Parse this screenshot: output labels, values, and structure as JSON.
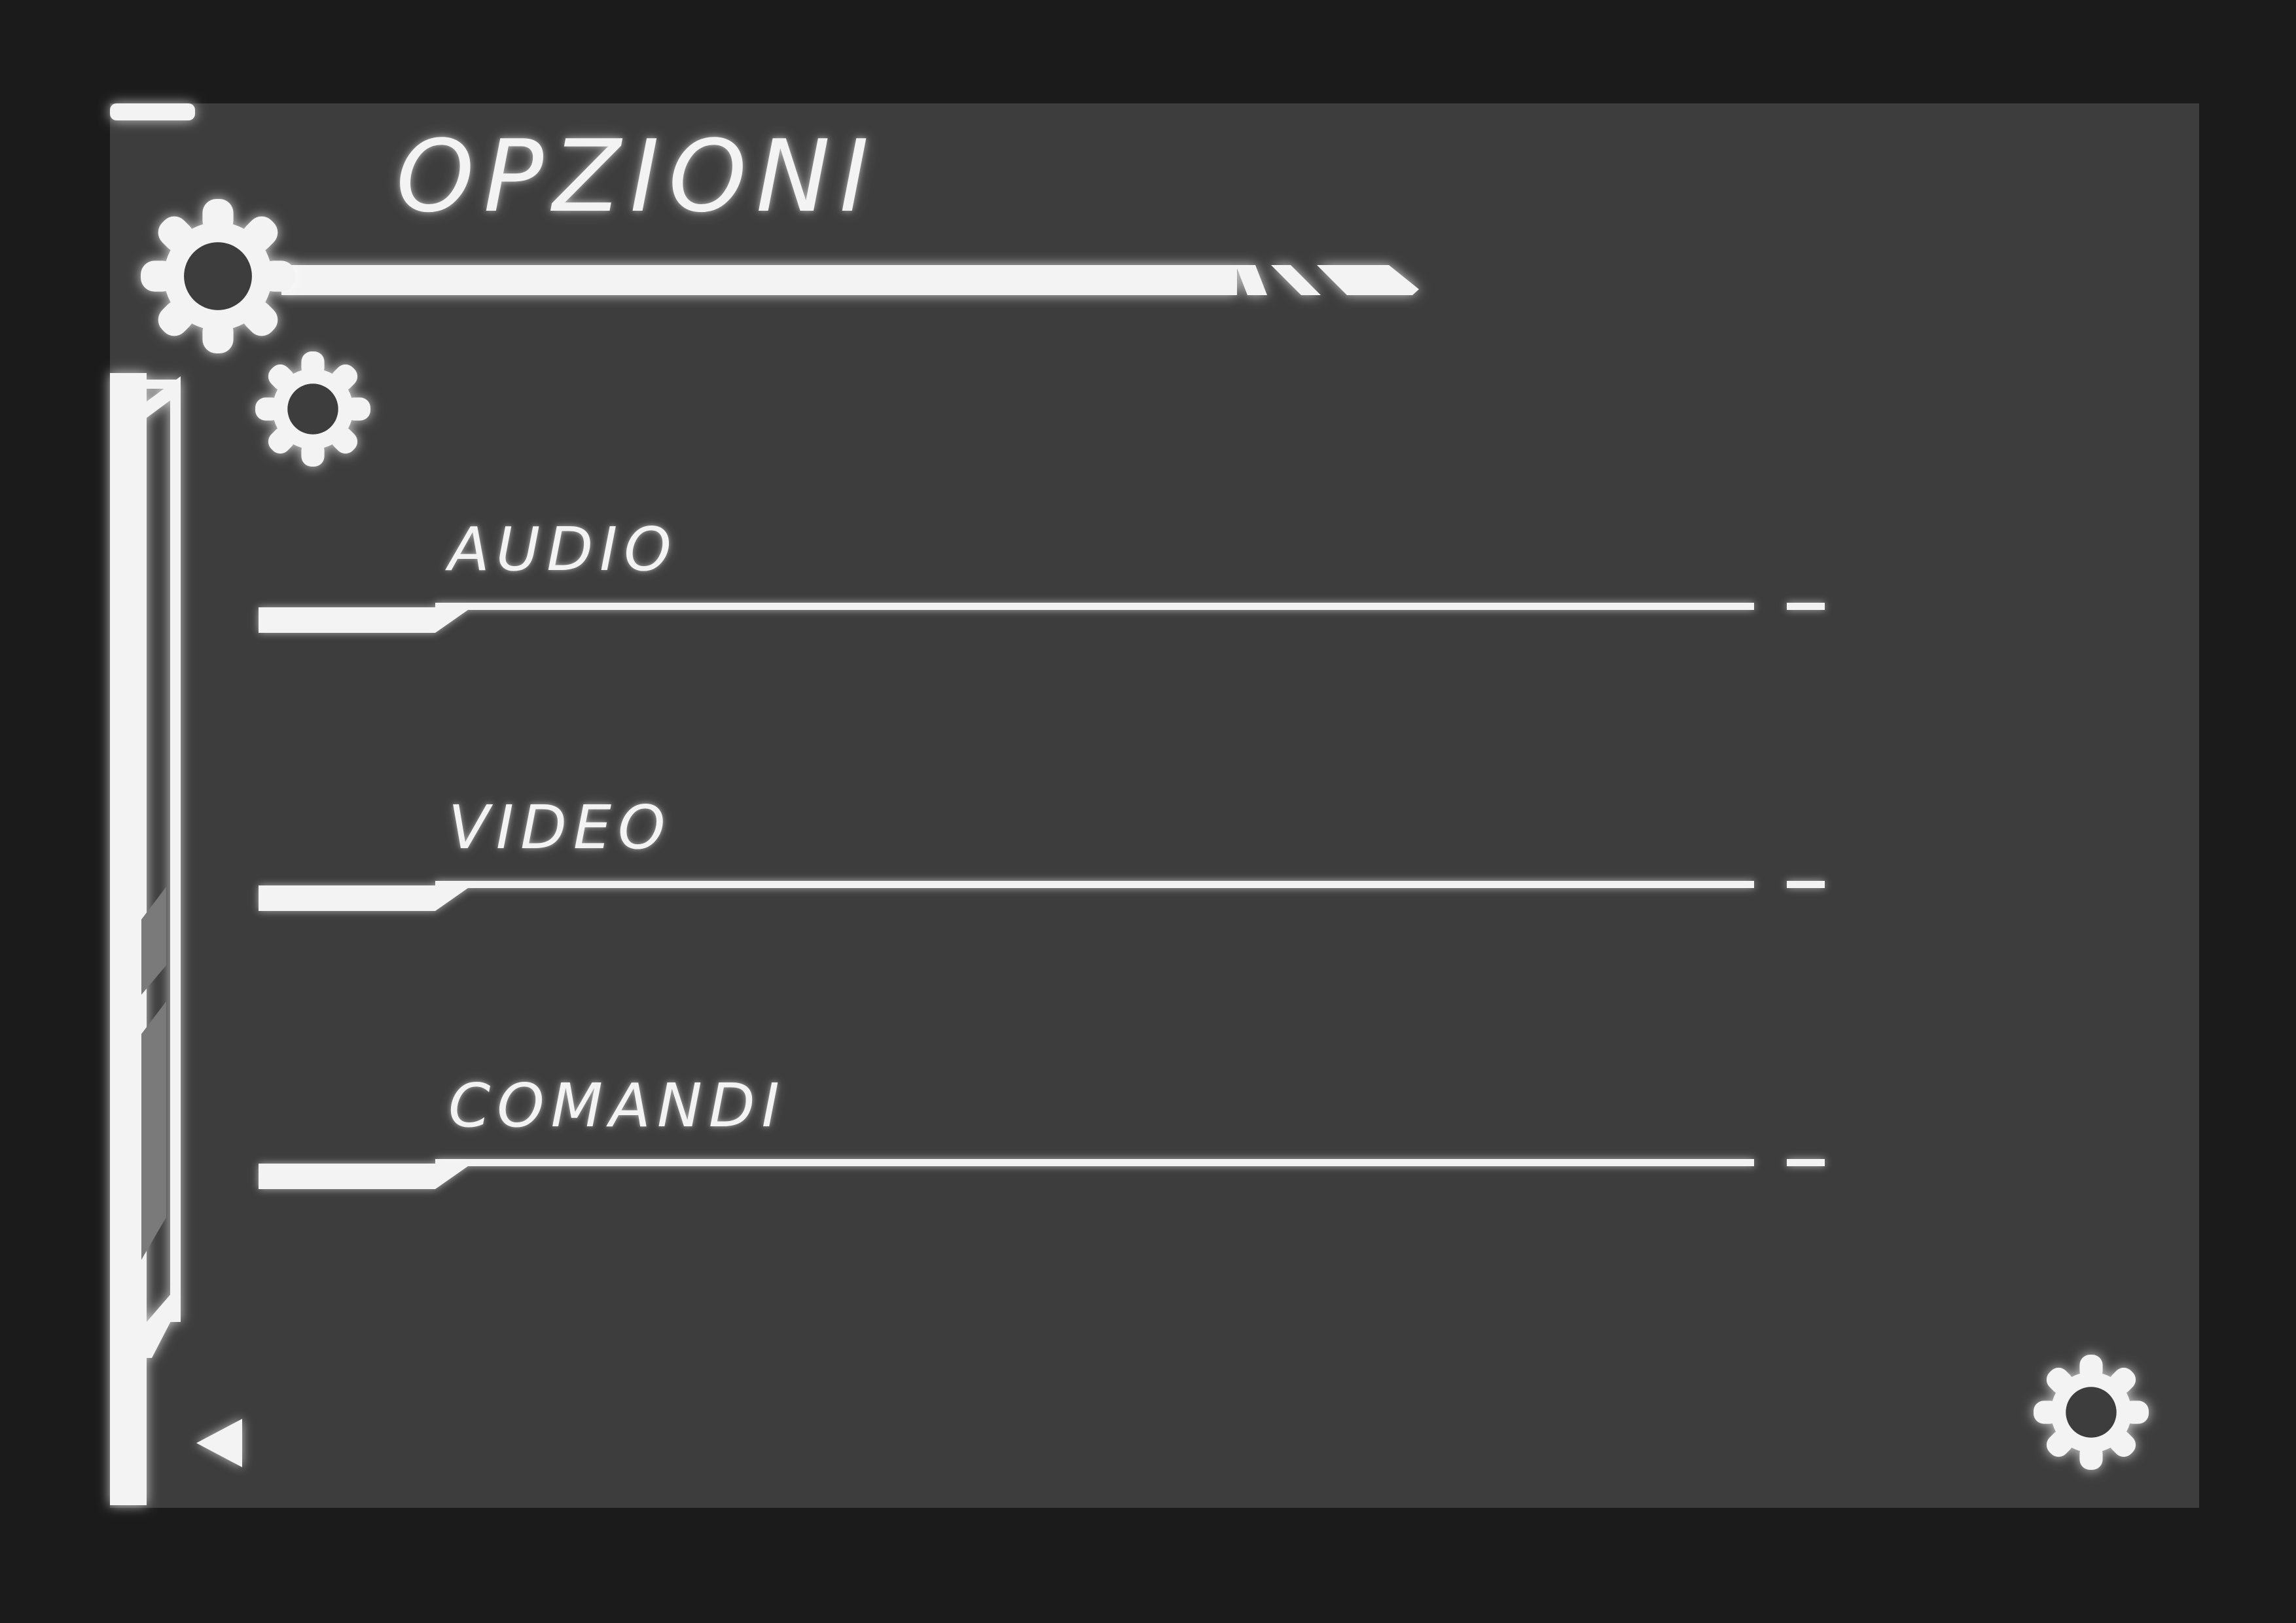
{
  "screen": {
    "title": "OPZIONI"
  },
  "menu": {
    "items": [
      {
        "label": "AUDIO"
      },
      {
        "label": "VIDEO"
      },
      {
        "label": "COMANDI"
      }
    ]
  },
  "icons": {
    "back": "back-arrow-icon",
    "gear": "gear-icon"
  },
  "colors": {
    "background": "#1b1b1b",
    "panel": "#3d3d3d",
    "foreground": "#f3f3f3",
    "accent_grey": "#7a7a7a"
  }
}
